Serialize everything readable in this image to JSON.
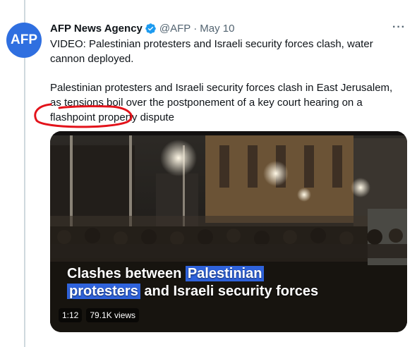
{
  "account": {
    "avatar_text": "AFP",
    "name": "AFP News Agency",
    "handle": "@AFP",
    "separator": "·",
    "date": "May 10",
    "more_icon": "more-horizontal-icon",
    "verified_icon": "verified-badge-icon"
  },
  "tweet": {
    "line1": "VIDEO:  Palestinian protesters and Israeli security forces clash, water cannon deployed.",
    "line2": "Palestinian protesters and Israeli security forces clash in East Jerusalem, as tensions boil over the postponement of a key court hearing on a flashpoint property dispute"
  },
  "video": {
    "caption_line1_pre": "Clashes between ",
    "caption_line1_hl": "Palestinian",
    "caption_line2_hl": "protesters",
    "caption_line2_post": " and Israeli security forces",
    "duration": "1:12",
    "views": "79.1K views"
  },
  "colors": {
    "verified": "#1d9bf0",
    "avatar_bg": "#2f6fe0",
    "annotation": "#e3131b",
    "caption_highlight": "#2f63dc"
  }
}
